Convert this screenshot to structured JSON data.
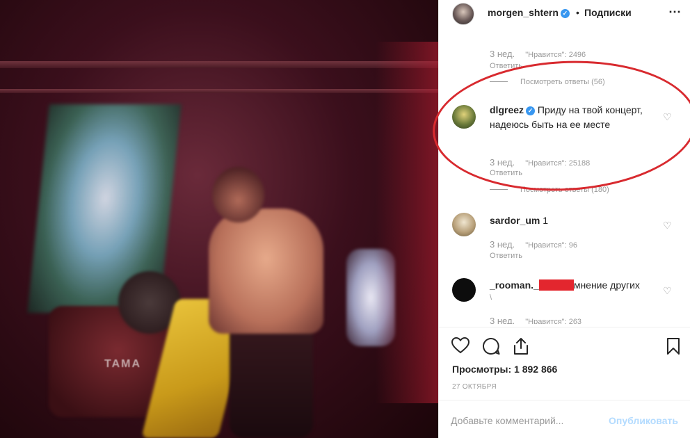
{
  "post": {
    "username": "morgen_shtern",
    "verified_icon": "verified-badge-icon",
    "separator": "•",
    "follow_label": "Подписки",
    "more_icon": "⋯"
  },
  "photo": {
    "drum_brand": "TAMA"
  },
  "comments": [
    {
      "time": "3 нед.",
      "likes": "\"Нравится\": 2496",
      "reply": "Ответить",
      "view_replies": "Посмотреть ответы (56)"
    },
    {
      "username": "dlgreez",
      "text": "Приду на твой концерт, надеюсь быть на ее месте",
      "time": "3 нед.",
      "likes": "\"Нравится\": 25188",
      "reply": "Ответить",
      "view_replies": "Посмотреть ответы (180)"
    },
    {
      "username": "sardor_um",
      "text": "1",
      "time": "3 нед.",
      "likes": "\"Нравится\": 96",
      "reply": "Ответить"
    },
    {
      "username": "_rooman._",
      "text": "мнение других",
      "text2": "\\",
      "time": "3 нед.",
      "likes": "\"Нравится\": 263"
    }
  ],
  "actions": {
    "views": "Просмотры: 1 892 866",
    "date": "27 ОКТЯБРЯ"
  },
  "add_comment": {
    "placeholder": "Добавьте комментарий...",
    "publish": "Опубликовать"
  },
  "colors": {
    "accent": "#3897f0",
    "annotation_red": "#d82a2f",
    "redaction": "#e3262e",
    "muted_text": "#999999"
  }
}
